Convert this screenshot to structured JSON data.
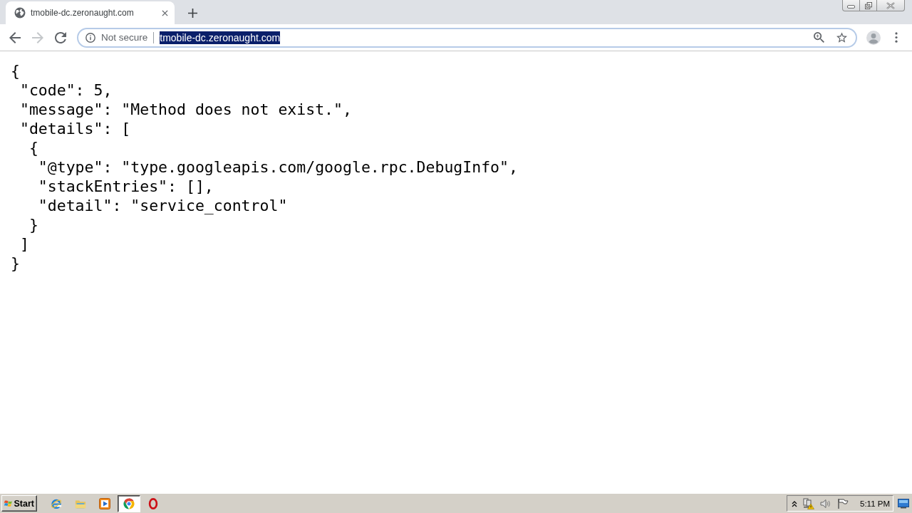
{
  "tabs": [
    {
      "title": "tmobile-dc.zeronaught.com",
      "selected": true
    }
  ],
  "toolbar": {
    "back": {
      "disabled": false
    },
    "forward": {
      "disabled": true
    }
  },
  "address_bar": {
    "focused": true,
    "security_label": "Not secure",
    "url": "tmobile-dc.zeronaught.com",
    "url_selected": true
  },
  "page": {
    "lines": [
      "{",
      " \"code\": 5,",
      " \"message\": \"Method does not exist.\",",
      " \"details\": [",
      "  {",
      "   \"@type\": \"type.googleapis.com/google.rpc.DebugInfo\",",
      "   \"stackEntries\": [],",
      "   \"detail\": \"service_control\"",
      "  }",
      " ]",
      "}"
    ]
  },
  "taskbar": {
    "start_label": "Start",
    "apps": [
      {
        "kind": "ie",
        "selected": false
      },
      {
        "kind": "folder",
        "selected": false
      },
      {
        "kind": "media",
        "selected": false
      },
      {
        "kind": "chrome",
        "selected": true
      },
      {
        "kind": "opera",
        "selected": false
      }
    ],
    "clock": "5:11 PM"
  }
}
